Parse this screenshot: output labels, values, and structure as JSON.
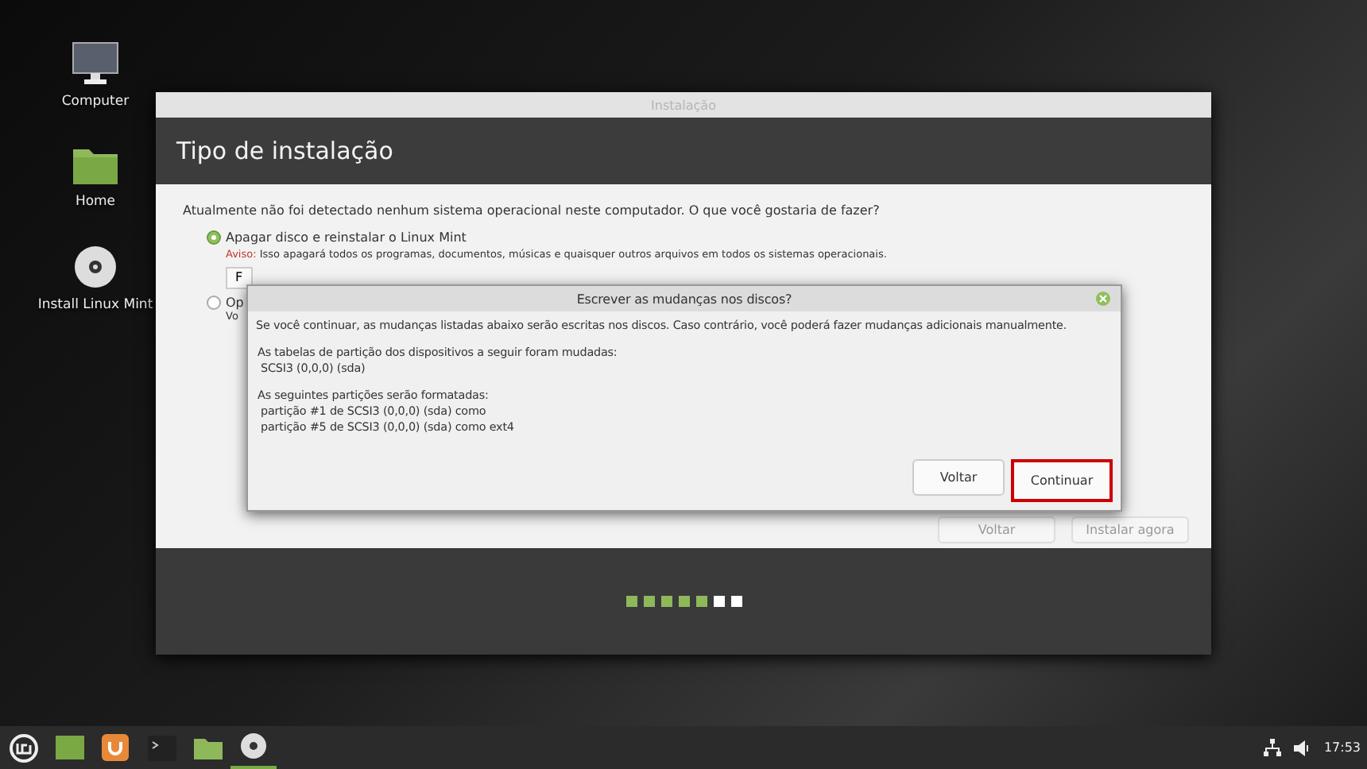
{
  "desktop_icons": [
    {
      "kind": "monitor",
      "label": "Computer"
    },
    {
      "kind": "folder",
      "label": "Home"
    },
    {
      "kind": "disc",
      "label": "Install Linux Mint"
    }
  ],
  "window": {
    "title": "Instalação",
    "heading": "Tipo de instalação",
    "question": "Atualmente não foi detectado nenhum sistema operacional neste computador. O que você gostaria de fazer?",
    "options": [
      {
        "label": "Apagar disco e reinstalar o Linux Mint",
        "selected": true,
        "warning_label": "Aviso:",
        "warning": "Isso apagará todos os programas, documentos, músicas e quaisquer outros arquivos em todos os sistemas operacionais.",
        "button": "F"
      },
      {
        "label": "Op",
        "selected": false,
        "description": "Vo"
      }
    ],
    "buttons": [
      {
        "label": "Voltar",
        "disabled": true
      },
      {
        "label": "Instalar agora",
        "disabled": true
      }
    ],
    "steps": [
      {
        "done": true
      },
      {
        "done": true
      },
      {
        "done": true
      },
      {
        "done": true
      },
      {
        "done": true
      },
      {
        "done": false
      },
      {
        "done": false
      }
    ]
  },
  "dialog": {
    "title": "Escrever as mudanças nos discos?",
    "intro": "Se você continuar, as mudanças listadas abaixo serão escritas nos discos. Caso contrário, você poderá fazer mudanças adicionais manualmente.",
    "sections": [
      {
        "heading": "As tabelas de partição dos dispositivos a seguir foram mudadas:",
        "items": [
          "SCSI3 (0,0,0) (sda)"
        ]
      },
      {
        "heading": "As seguintes partições serão formatadas:",
        "items": [
          "partição #1 de SCSI3 (0,0,0) (sda) como",
          "partição #5 de SCSI3 (0,0,0) (sda) como ext4"
        ]
      }
    ],
    "buttons": [
      {
        "label": "Voltar",
        "highlighted": false
      },
      {
        "label": "Continuar",
        "highlighted": true
      }
    ]
  },
  "taskbar": {
    "items": [
      {
        "kind": "menu",
        "active": false
      },
      {
        "kind": "desktop",
        "active": false
      },
      {
        "kind": "app",
        "active": false
      },
      {
        "kind": "terminal",
        "active": false
      },
      {
        "kind": "files",
        "active": false
      },
      {
        "kind": "disc",
        "active": true
      }
    ],
    "clock": "17:53"
  }
}
